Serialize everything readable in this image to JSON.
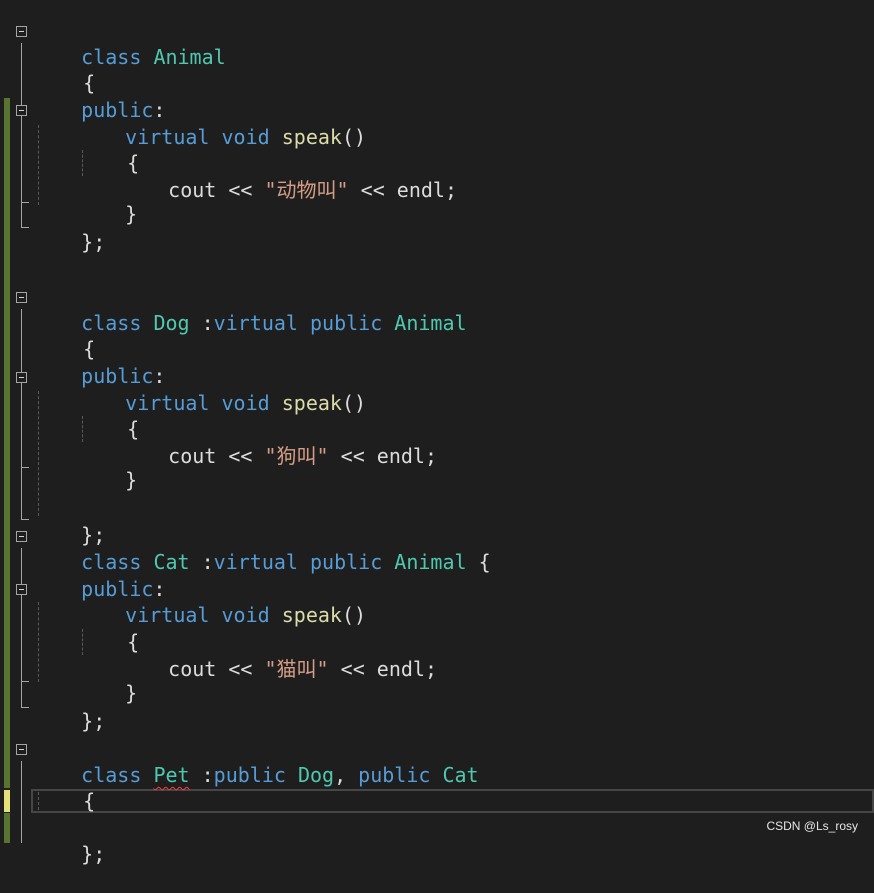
{
  "editor": {
    "code": {
      "l1": {
        "a": "class",
        "b": " ",
        "c": "Animal"
      },
      "l2": {
        "a": "{"
      },
      "l3": {
        "a": "public",
        "b": ":"
      },
      "l4": {
        "a": "virtual",
        "b": " ",
        "c": "void",
        "d": " ",
        "e": "speak",
        "f": "()"
      },
      "l5": {
        "a": "{"
      },
      "l6": {
        "a": "cout",
        "b": " << ",
        "c": "\"动物叫\"",
        "d": " << endl;"
      },
      "l7": {
        "a": "}"
      },
      "l8": {
        "a": "};"
      },
      "l11": {
        "a": "class",
        "b": " ",
        "c": "Dog",
        "d": " :",
        "e": "virtual",
        "f": " ",
        "g": "public",
        "h": " ",
        "i": "Animal"
      },
      "l12": {
        "a": "{"
      },
      "l13": {
        "a": "public",
        "b": ":"
      },
      "l14": {
        "a": "virtual",
        "b": " ",
        "c": "void",
        "d": " ",
        "e": "speak",
        "f": "()"
      },
      "l15": {
        "a": "{"
      },
      "l16": {
        "a": "cout",
        "b": " << ",
        "c": "\"狗叫\"",
        "d": " << endl;"
      },
      "l17": {
        "a": "}"
      },
      "l19": {
        "a": "};"
      },
      "l20": {
        "a": "class",
        "b": " ",
        "c": "Cat",
        "d": " :",
        "e": "virtual",
        "f": " ",
        "g": "public",
        "h": " ",
        "i": "Animal",
        "j": " {"
      },
      "l21": {
        "a": "public",
        "b": ":"
      },
      "l22": {
        "a": "virtual",
        "b": " ",
        "c": "void",
        "d": " ",
        "e": "speak",
        "f": "()"
      },
      "l23": {
        "a": "{"
      },
      "l24": {
        "a": "cout",
        "b": " << ",
        "c": "\"猫叫\"",
        "d": " << endl;"
      },
      "l25": {
        "a": "}"
      },
      "l26": {
        "a": "};"
      },
      "l28": {
        "a": "class",
        "b": " ",
        "c": "Pet",
        "d": " :",
        "e": "public",
        "f": " ",
        "g": "Dog",
        "h": ", ",
        "i": "public",
        "j": " ",
        "k": "Cat"
      },
      "l29": {
        "a": "{"
      },
      "l31": {
        "a": "};"
      }
    },
    "colors": {
      "background": "#1e1e1e",
      "keyword": "#569cd6",
      "type": "#4ec9b0",
      "function": "#dcdcaa",
      "string": "#d69d85",
      "plain": "#dcdcdc",
      "change_saved": "#577430",
      "change_unsaved": "#e6e27a"
    }
  },
  "watermark": "CSDN @Ls_rosy"
}
